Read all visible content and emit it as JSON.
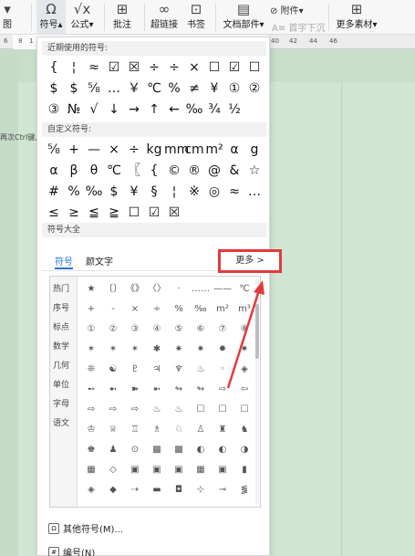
{
  "ribbon": {
    "symbol_label": "符号",
    "formula_label": "公式",
    "comment_label": "批注",
    "hyperlink_label": "超链接",
    "bookmark_label": "书签",
    "docpart_label": "文档部件",
    "attachment_label": "附件",
    "dropcap_label": "首字下沉",
    "material_label": "更多素材",
    "left_label": "图"
  },
  "ruler": {
    "ticks_left": [
      "6",
      "8",
      "1"
    ],
    "ticks_right": [
      "40",
      "42",
      "44",
      "46"
    ]
  },
  "document": {
    "hint_text": "再次Ctrl键,"
  },
  "panel": {
    "recent_header": "近期使用的符号:",
    "recent_symbols": [
      "{",
      "¦",
      "≈",
      "☑",
      "☒",
      "÷",
      "÷",
      "×",
      "☐",
      "☑",
      "☐",
      "$",
      "$",
      "⅝",
      "…",
      "￥",
      "℃",
      "%",
      "≠",
      "¥",
      "①",
      "②",
      "③",
      "№",
      "√",
      "↓",
      "→",
      "↑",
      "←",
      "‰",
      "¾",
      "½"
    ],
    "custom_header": "自定义符号:",
    "custom_symbols": [
      "⅝",
      "+",
      "—",
      "×",
      "÷",
      "kg",
      "mm",
      "cm",
      "m²",
      "α",
      "g",
      "α",
      "β",
      "θ",
      "℃",
      "〖",
      "{",
      "©",
      "®",
      "@",
      "&",
      "☆",
      "#",
      "%",
      "‰",
      "$",
      "¥",
      "§",
      "¦",
      "※",
      "◎",
      "≈",
      "…",
      "≤",
      "≥",
      "≦",
      "≧",
      "☐",
      "☑",
      "☒"
    ],
    "library_header": "符号大全",
    "tab_symbols": "符号",
    "tab_emoticons": "颜文字",
    "more_button": "更多 >",
    "categories": [
      "热门",
      "序号",
      "标点",
      "数学",
      "几何",
      "单位",
      "字母",
      "语文"
    ],
    "library_symbols": [
      [
        "★",
        "〔〕",
        "《》",
        "〈〉",
        "·",
        "……",
        "——",
        "℃"
      ],
      [
        "+",
        "-",
        "×",
        "÷",
        "%",
        "‰",
        "m²",
        "m³"
      ],
      [
        "①",
        "②",
        "③",
        "④",
        "⑤",
        "⑥",
        "⑦",
        "⑧"
      ],
      [
        "✶",
        "✶",
        "✶",
        "✱",
        "✷",
        "✷",
        "✹",
        "✷"
      ],
      [
        "❊",
        "☯",
        "♇",
        "♃",
        "♆",
        "♨",
        "◦",
        "◈"
      ],
      [
        "➻",
        "➼",
        "➽",
        "➼",
        "↬",
        "↬",
        "⇨",
        "⇦"
      ],
      [
        "⇨",
        "⇨",
        "⇨",
        "♨",
        "♨",
        "☐",
        "☐",
        "☐"
      ],
      [
        "♔",
        "♕",
        "♖",
        "♗",
        "♘",
        "♙",
        "♜",
        "♞"
      ],
      [
        "♚",
        "♟",
        "⊙",
        "▩",
        "▩",
        "◐",
        "◐",
        "◑"
      ],
      [
        "▦",
        "◇",
        "▣",
        "▣",
        "▣",
        "▦",
        "▣",
        "▮"
      ],
      [
        "◈",
        "◆",
        "⇢",
        "▬",
        "◘",
        "⊹",
        "⊸",
        "⪓"
      ]
    ],
    "other_symbols": "其他符号(M)...",
    "numbering": "编号(N)"
  }
}
